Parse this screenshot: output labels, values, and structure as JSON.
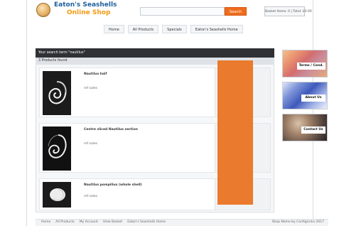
{
  "header": {
    "logo_title": "Eaton's Seashells",
    "logo_subtitle": "Online Shop",
    "search_button": "Search",
    "basket_summary": "Basket Items: 0 | Total: £0.00"
  },
  "nav": {
    "items": [
      {
        "label": "Home"
      },
      {
        "label": "All Products"
      },
      {
        "label": "Specials"
      },
      {
        "label": "Eaton's Seashells Home"
      }
    ]
  },
  "results": {
    "search_label": "Your search term \"nautilus\"",
    "found_label": "3 Products found"
  },
  "products": [
    {
      "name": "Nautilus half",
      "price": "ref sales"
    },
    {
      "name": "Centre sliced Nautilus section",
      "price": "ref sales"
    },
    {
      "name": "Nautilus pompilius (whole shell)",
      "price": "ref sales"
    }
  ],
  "sidebar": {
    "tiles": [
      {
        "label": "Terms / Cond."
      },
      {
        "label": "About Us"
      },
      {
        "label": "Contact Us"
      }
    ]
  },
  "footer": {
    "links": [
      {
        "label": "Home"
      },
      {
        "label": "All Products"
      },
      {
        "label": "My Account"
      },
      {
        "label": "View Basket"
      },
      {
        "label": "Eaton's Seashells Home"
      }
    ],
    "right_text": "Shop Name by ConfigLinks 2017"
  },
  "colors": {
    "accent_orange": "#ea7a2d",
    "brand_blue": "#1d5f9a"
  },
  "icons": {
    "logo": "seashell-icon"
  }
}
